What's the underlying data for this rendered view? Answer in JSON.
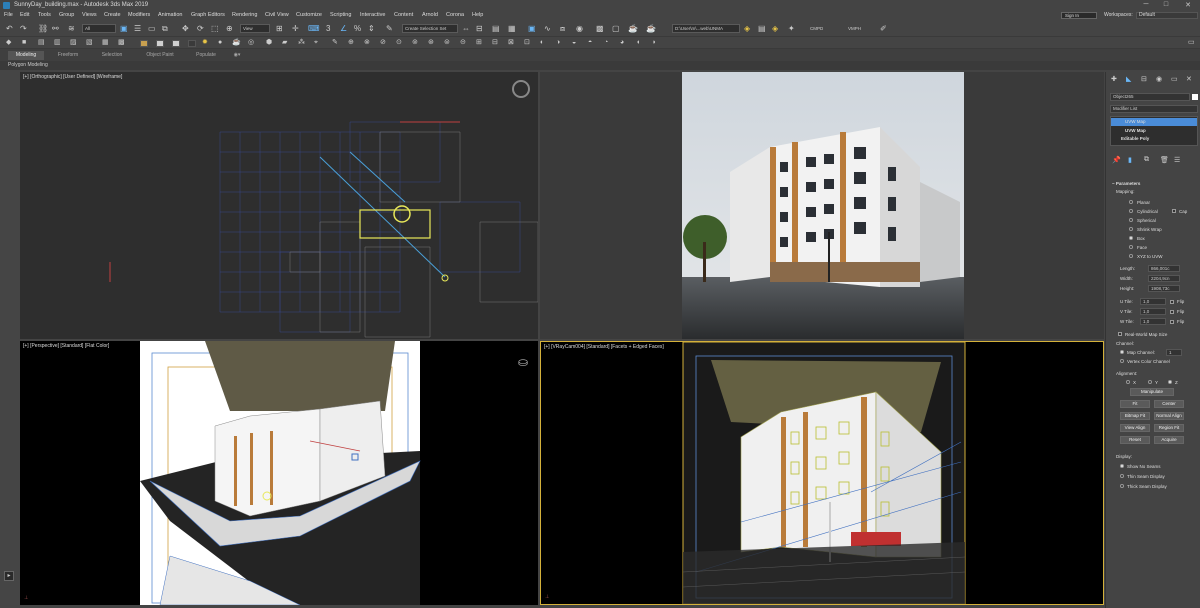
{
  "window": {
    "title": "SunnyDay_building.max - Autodesk 3ds Max 2019",
    "controls": {
      "minimize": "─",
      "maximize": "□",
      "close": "✕"
    }
  },
  "menubar": {
    "items": [
      "File",
      "Edit",
      "Tools",
      "Group",
      "Views",
      "Create",
      "Modifiers",
      "Animation",
      "Graph Editors",
      "Rendering",
      "Civil View",
      "Customize",
      "Scripting",
      "Interactive",
      "Content",
      "Arnold",
      "Corona",
      "Help"
    ],
    "signin": "Sign In",
    "workspaces_label": "Workspaces:",
    "workspaces_value": "Default"
  },
  "toolbar": {
    "filter": "All",
    "view": "View",
    "selection_set": "Create Selection Set",
    "project_path": "D:\\User\\m\\...web\\UNMA",
    "cmds": [
      "CMPD",
      "VMPH"
    ]
  },
  "ribbon": {
    "tabs": [
      "Modeling",
      "Freeform",
      "Selection",
      "Object Paint",
      "Populate"
    ],
    "active_tab": "Modeling",
    "subtitle": "Polygon Modeling"
  },
  "viewports": {
    "top": {
      "label": "[+] [Orthographic] [User Defined] [Wireframe]"
    },
    "persp": {
      "label": "[+] [Perspective] [Standard] [Flat Color]"
    },
    "camera": {
      "label": "[+] [VRayCam004] [Standard] [Facets + Edged Faces]"
    }
  },
  "command_panel": {
    "object_name": "Object265",
    "modifier_list": "Modifier List",
    "stack": [
      {
        "name": "UVW Map",
        "selected": true
      },
      {
        "name": "UVW Map",
        "selected": false
      },
      {
        "name": "Editable Poly",
        "selected": false
      }
    ],
    "rollout": "Parameters",
    "mapping_label": "Mapping:",
    "mapping": [
      "Planar",
      "Cylindrical",
      "Spherical",
      "Shrink Wrap",
      "Box",
      "Face",
      "XYZ to UVW"
    ],
    "mapping_selected": "Box",
    "cap_label": "Cap",
    "length_label": "Length:",
    "length_value": "866,001c",
    "width_label": "Width:",
    "width_value": "2204,9cn",
    "height_label": "Height:",
    "height_value": "1908,73c",
    "utile_label": "U Tile:",
    "utile_value": "1,0",
    "vtile_label": "V Tile:",
    "vtile_value": "1,0",
    "wtile_label": "W Tile:",
    "wtile_value": "1,0",
    "flip_label": "Flip",
    "realworld_label": "Real-World Map Size",
    "channel_label": "Channel:",
    "map_channel_label": "Map Channel:",
    "map_channel_value": "1",
    "vertex_color_label": "Vertex Color Channel",
    "alignment_label": "Alignment:",
    "axes": [
      "X",
      "Y",
      "Z"
    ],
    "axis_selected": "Z",
    "manipulate": "Manipulate",
    "buttons": [
      [
        "Fit",
        "Center"
      ],
      [
        "Bitmap Fit",
        "Normal Align"
      ],
      [
        "View Align",
        "Region Fit"
      ],
      [
        "Reset",
        "Acquire"
      ]
    ],
    "display_label": "Display:",
    "display": [
      "Show No Seams",
      "Thin Seam Display",
      "Thick Seam Display"
    ],
    "display_selected": "Show No Seams"
  }
}
